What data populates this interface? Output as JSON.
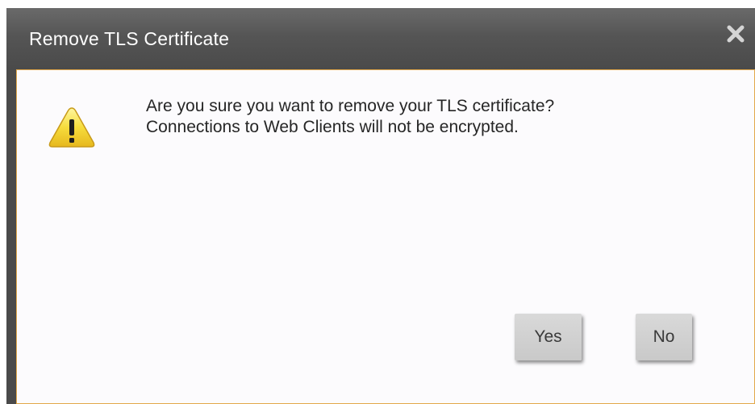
{
  "dialog": {
    "title": "Remove TLS Certificate",
    "close_icon": "close-icon",
    "warning_icon": "warning-icon",
    "message_line1": "Are you sure you want to remove your TLS certificate?",
    "message_line2": "Connections to Web Clients will not be encrypted.",
    "yes_label": "Yes",
    "no_label": "No"
  },
  "colors": {
    "titlebar": "#4a4a4a",
    "content_bg": "#fcfbfd",
    "content_border": "#e2a84a",
    "warning_fill": "#f6dc3c",
    "button_bg": "#d0d0d0"
  }
}
